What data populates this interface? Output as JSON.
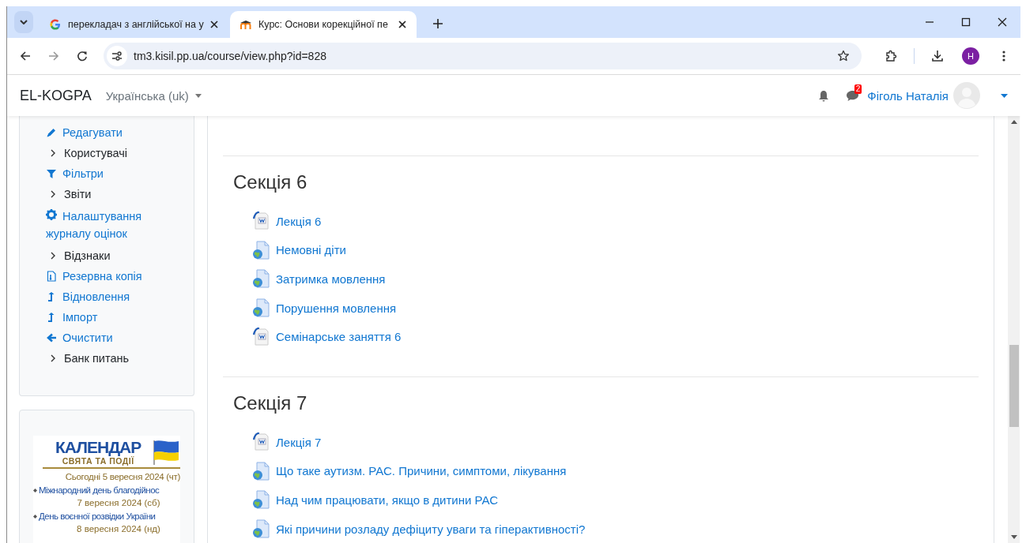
{
  "browser": {
    "tabs": [
      {
        "title": "перекладач з англійської на у",
        "selected": false
      },
      {
        "title": "Курс: Основи корекційної пе",
        "selected": true
      }
    ],
    "url": "tm3.kisil.pp.ua/course/view.php?id=828",
    "profile_initial": "H"
  },
  "navbar": {
    "brand": "EL-KOGPA",
    "language": "Українська (uk)",
    "message_count": "2",
    "user_name": "Фіголь Наталія"
  },
  "drawer": {
    "items": [
      {
        "label": "Редагувати",
        "kind": "edit"
      },
      {
        "label": "Користувачі",
        "kind": "chevron"
      },
      {
        "label": "Фільтри",
        "kind": "filter"
      },
      {
        "label": "Звіти",
        "kind": "chevron"
      },
      {
        "label": "Налаштування журналу оцінок",
        "kind": "gear"
      },
      {
        "label": "Відзнаки",
        "kind": "chevron"
      },
      {
        "label": "Резервна копія",
        "kind": "backup"
      },
      {
        "label": "Відновлення",
        "kind": "upload"
      },
      {
        "label": "Імпорт",
        "kind": "upload"
      },
      {
        "label": "Очистити",
        "kind": "back"
      },
      {
        "label": "Банк питань",
        "kind": "chevron"
      }
    ]
  },
  "calendar": {
    "title": "КАЛЕНДАР",
    "subtitle": "СВЯТА ТА ПОДІЇ",
    "today": "Сьогодні 5 вересня 2024 (чт)",
    "events": [
      {
        "name": "Міжнародний день благодійнос",
        "date": "7 вересня 2024 (сб)"
      },
      {
        "name": "День воєнної розвідки України",
        "date": "8 вересня 2024 (нд)"
      }
    ]
  },
  "sections": [
    {
      "title": "Секція 6",
      "items": [
        {
          "label": "Лекція 6",
          "kind": "word"
        },
        {
          "label": "Немовні діти",
          "kind": "url"
        },
        {
          "label": "Затримка мовлення",
          "kind": "url"
        },
        {
          "label": "Порушення мовлення",
          "kind": "url"
        },
        {
          "label": "Семінарське заняття 6",
          "kind": "word"
        }
      ]
    },
    {
      "title": "Секція 7",
      "items": [
        {
          "label": "Лекція 7",
          "kind": "word"
        },
        {
          "label": "Що таке аутизм. РАС. Причини, симптоми, лікування",
          "kind": "url"
        },
        {
          "label": "Над чим працювати, якщо в дитини РАС",
          "kind": "url"
        },
        {
          "label": "Які причини розладу дефіциту уваги та гіперактивності?",
          "kind": "url"
        }
      ]
    }
  ]
}
